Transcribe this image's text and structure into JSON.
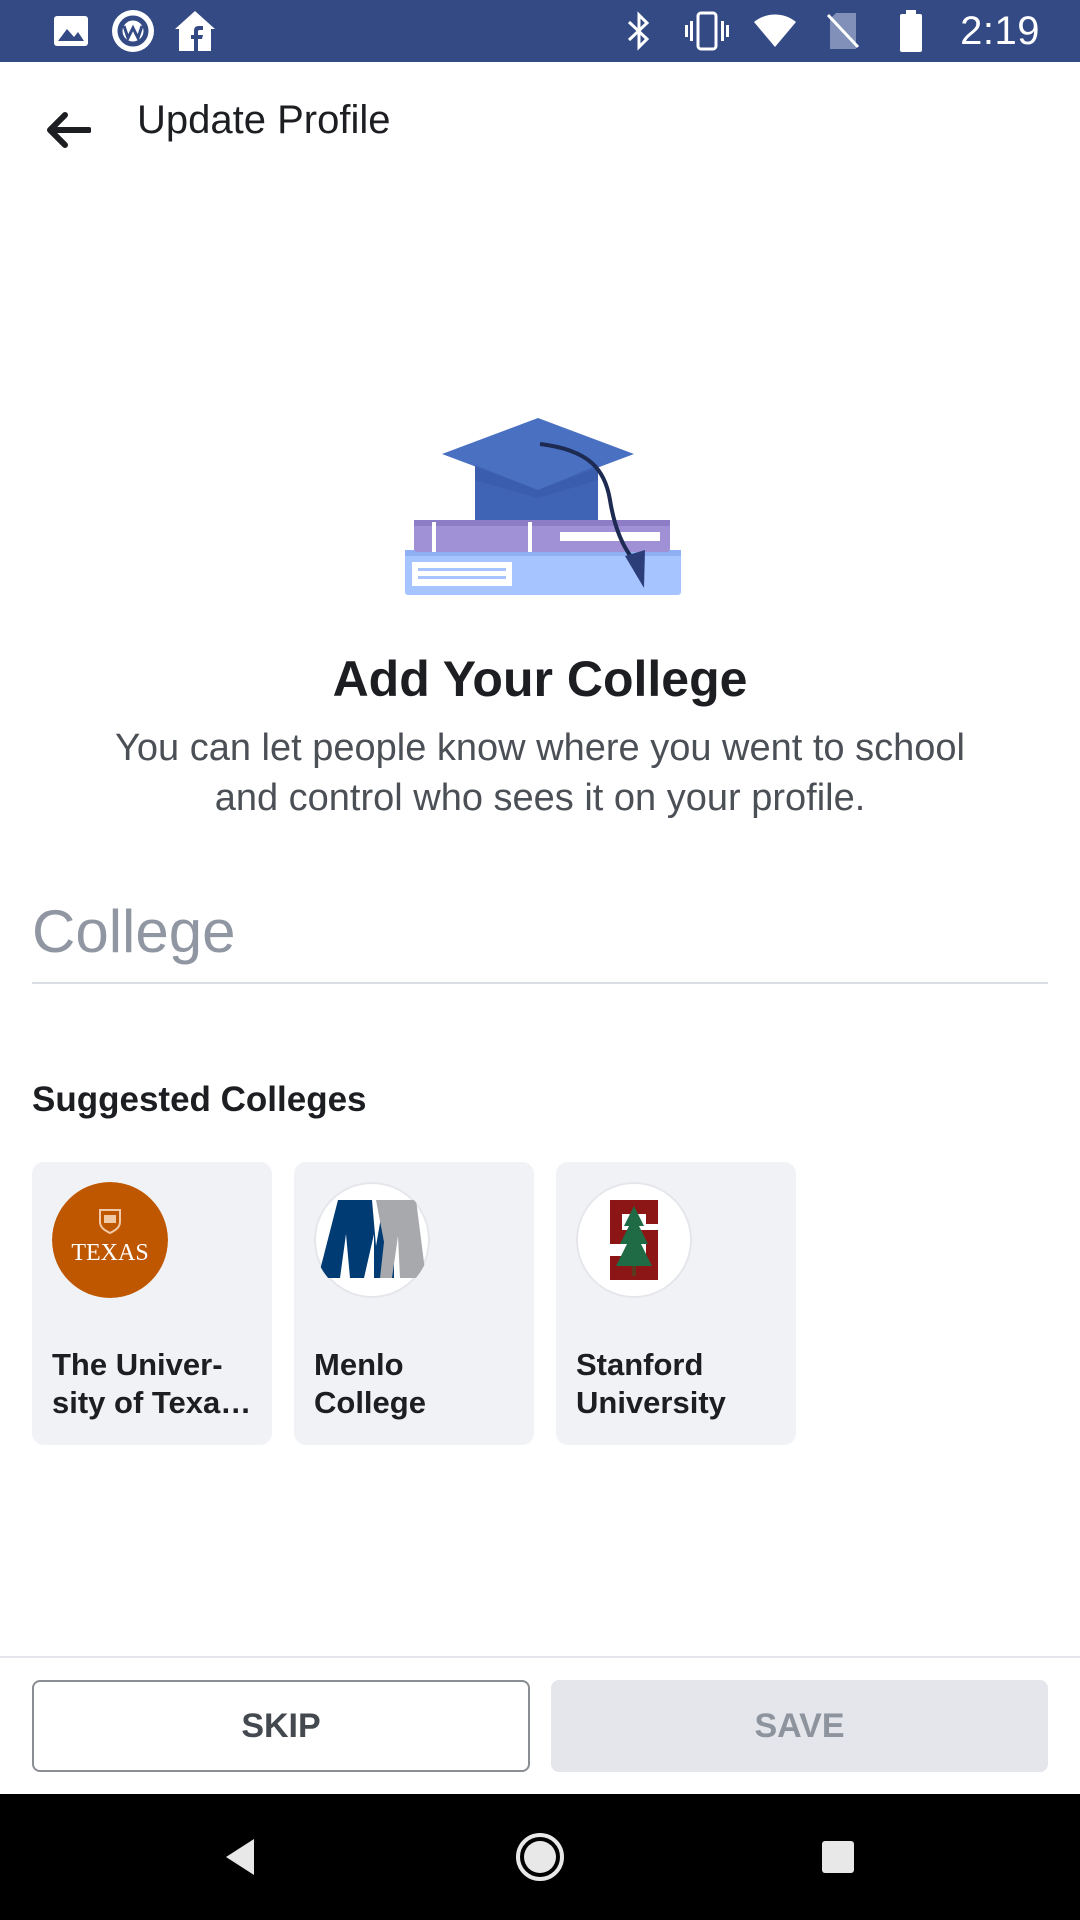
{
  "status_bar": {
    "time": "2:19",
    "left_icons": [
      "image-icon",
      "workplace-icon",
      "facebook-home-icon"
    ],
    "right_icons": [
      "bluetooth-icon",
      "vibrate-icon",
      "wifi-icon",
      "no-sim-icon",
      "battery-icon"
    ]
  },
  "app_bar": {
    "title": "Update Profile",
    "back_icon": "arrow-left-icon"
  },
  "main": {
    "illustration": "graduation-cap-books-illustration",
    "headline": "Add Your College",
    "description": "You can let people know where you went to school and control who sees it on your profile.",
    "college_input": {
      "placeholder": "College",
      "value": ""
    }
  },
  "suggested": {
    "title": "Suggested Colleges",
    "colleges": [
      {
        "name": "The Univer- sity of Texa…",
        "logo_text": "TEXAS",
        "logo_color": "#bf5700"
      },
      {
        "name": "Menlo College",
        "logo_text": "M",
        "logo_color": "#003b73"
      },
      {
        "name": "Stanford University",
        "logo_text": "S",
        "logo_color": "#8c1515"
      }
    ]
  },
  "actions": {
    "skip_label": "SKIP",
    "save_label": "SAVE"
  },
  "nav_bar": {
    "icons": [
      "back-triangle-icon",
      "home-circle-icon",
      "recents-square-icon"
    ]
  },
  "colors": {
    "status_bar": "#344a84",
    "card_bg": "#f0f2f5",
    "save_disabled_bg": "#e4e6eb"
  }
}
